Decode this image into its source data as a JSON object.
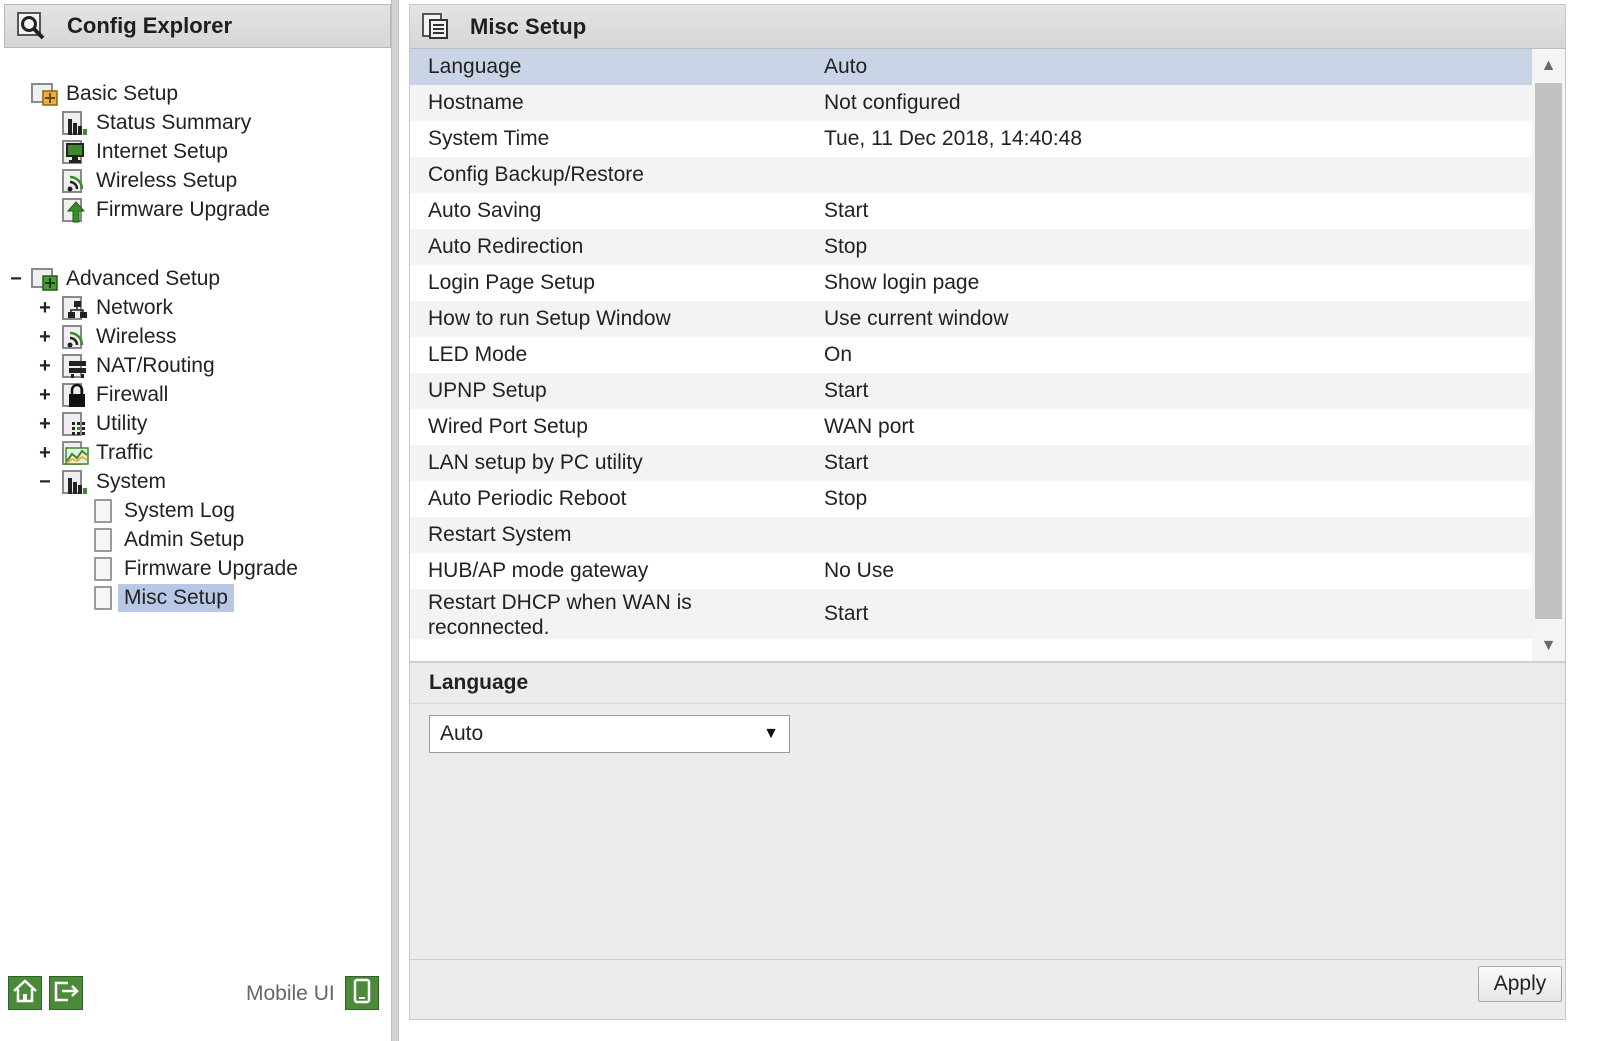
{
  "left": {
    "title": "Config Explorer",
    "mobile_label": "Mobile UI"
  },
  "tree": {
    "basic_setup": "Basic Setup",
    "status_summary": "Status Summary",
    "internet_setup": "Internet Setup",
    "wireless_setup": "Wireless Setup",
    "firmware_upgrade_basic": "Firmware Upgrade",
    "advanced_setup": "Advanced Setup",
    "network": "Network",
    "wireless": "Wireless",
    "nat_routing": "NAT/Routing",
    "firewall": "Firewall",
    "utility": "Utility",
    "traffic": "Traffic",
    "system": "System",
    "system_log": "System Log",
    "admin_setup": "Admin Setup",
    "firmware_upgrade_sys": "Firmware Upgrade",
    "misc_setup": "Misc Setup",
    "expand_symbol": "+",
    "collapse_symbol": "−"
  },
  "main": {
    "title": "Misc Setup",
    "rows": [
      {
        "key": "Language",
        "value": "Auto"
      },
      {
        "key": "Hostname",
        "value": "Not configured"
      },
      {
        "key": "System Time",
        "value": "Tue, 11 Dec 2018, 14:40:48"
      },
      {
        "key": "Config Backup/Restore",
        "value": ""
      },
      {
        "key": "Auto Saving",
        "value": "Start"
      },
      {
        "key": "Auto Redirection",
        "value": "Stop"
      },
      {
        "key": "Login Page Setup",
        "value": "Show login page"
      },
      {
        "key": "How to run Setup Window",
        "value": "Use current window"
      },
      {
        "key": "LED Mode",
        "value": "On"
      },
      {
        "key": "UPNP Setup",
        "value": "Start"
      },
      {
        "key": "Wired Port Setup",
        "value": "WAN port"
      },
      {
        "key": "LAN setup by PC utility",
        "value": "Start"
      },
      {
        "key": "Auto Periodic Reboot",
        "value": "Stop"
      },
      {
        "key": "Restart System",
        "value": ""
      },
      {
        "key": "HUB/AP mode gateway",
        "value": "No Use"
      },
      {
        "key": "Restart DHCP when WAN is",
        "value": "Start"
      }
    ],
    "row15_key_line2": "reconnected.",
    "detail_title": "Language",
    "language_selected": "Auto",
    "apply_label": "Apply"
  },
  "colors": {
    "selected_row": "#c9d4e6",
    "selected_tree": "#b8c7e6",
    "footer_button": "#4a8a3a"
  }
}
